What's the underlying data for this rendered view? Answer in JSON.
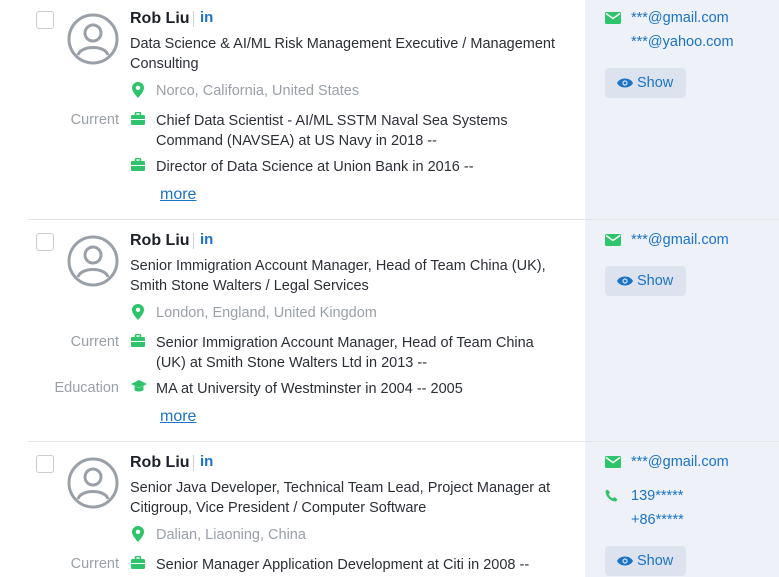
{
  "colors": {
    "accent": "#1a73c6",
    "icon_green": "#2ec46b",
    "muted": "#9aa0a8",
    "contact_bg": "#eef1f7"
  },
  "profiles": [
    {
      "name": "Rob Liu",
      "linkedin": "in",
      "headline": "Data Science & AI/ML Risk Management Executive / Management Consulting",
      "location": "Norco, California, United States",
      "current_label": "Current",
      "current": [
        "Chief Data Scientist - AI/ML SSTM Naval Sea Systems Command (NAVSEA) at US Navy in 2018 --",
        "Director of Data Science at Union Bank in 2016 --"
      ],
      "more": "more",
      "emails": [
        "***@gmail.com",
        "***@yahoo.com"
      ],
      "show": "Show"
    },
    {
      "name": "Rob Liu",
      "linkedin": "in",
      "headline": "Senior Immigration Account Manager, Head of Team China (UK), Smith Stone Walters / Legal Services",
      "location": "London, England, United Kingdom",
      "current_label": "Current",
      "current": [
        "Senior Immigration Account Manager, Head of Team China (UK) at Smith Stone Walters Ltd in 2013 --"
      ],
      "education_label": "Education",
      "education": [
        "MA at University of Westminster in 2004 -- 2005"
      ],
      "more": "more",
      "emails": [
        "***@gmail.com"
      ],
      "show": "Show"
    },
    {
      "name": "Rob Liu",
      "linkedin": "in",
      "headline": "Senior Java Developer, Technical Team Lead, Project Manager at Citigroup, Vice President / Computer Software",
      "location": "Dalian, Liaoning, China",
      "current_label": "Current",
      "current": [
        "Senior Manager Application Development at Citi in 2008 --"
      ],
      "emails": [
        "***@gmail.com"
      ],
      "phones": [
        "139*****",
        "+86*****"
      ],
      "show": "Show"
    }
  ]
}
